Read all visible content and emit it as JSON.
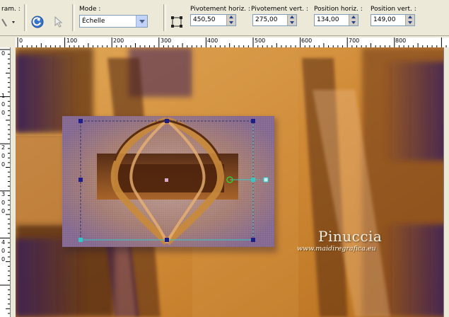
{
  "toolbar": {
    "presets_label": "ram. :",
    "mode_label": "Mode :",
    "mode_value": "Échelle",
    "pivot_h_label": "Pivotement horiz. :",
    "pivot_h_value": "450,50",
    "pivot_v_label": "Pivotement vert. :",
    "pivot_v_value": "275,00",
    "pos_h_label": "Position horiz. :",
    "pos_h_value": "134,00",
    "pos_v_label": "Position vert. :",
    "pos_v_value": "149,00"
  },
  "ruler_h": [
    "0",
    "100",
    "200",
    "300",
    "400",
    "500",
    "600",
    "700",
    "800"
  ],
  "ruler_v": [
    {
      "lines": [
        "0"
      ]
    },
    {
      "lines": [
        "1",
        "0",
        "0"
      ]
    },
    {
      "lines": [
        "2",
        "0",
        "0"
      ]
    },
    {
      "lines": [
        "3",
        "0",
        "0"
      ]
    },
    {
      "lines": [
        "4",
        "0",
        "0"
      ]
    }
  ],
  "watermark": {
    "name": "Pinuccia",
    "url": "www.maidiregrafica.eu"
  },
  "colors": {
    "orange": "#d08a36",
    "purple": "#3a1f5a",
    "brown": "#5a2d10",
    "handle": "#1e1e8a",
    "cyan": "#33c7c7"
  }
}
